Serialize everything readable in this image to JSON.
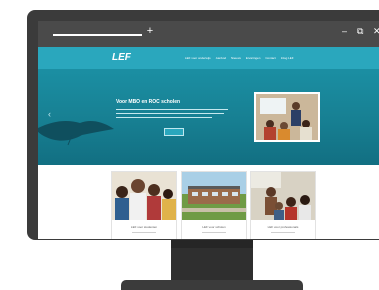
{
  "browser": {
    "new_tab_label": "+",
    "minimize_label": "–",
    "restore_label": "⧉",
    "close_label": "✕"
  },
  "site": {
    "logo": "LEF",
    "nav": [
      "LEF voor onderwijs",
      "Aanbod",
      "Nieuws",
      "Ervaringen",
      "Contact",
      "Inlog LEF"
    ],
    "hero_title": "Voor MBO en ROC scholen",
    "cards": [
      {
        "caption": "LEF voor studenten"
      },
      {
        "caption": "LEF voor scholen"
      },
      {
        "caption": "LEF voor professionals"
      }
    ]
  },
  "colors": {
    "accent": "#2aa7bd",
    "hero": "#177f92",
    "bezel": "#3b3b3b"
  }
}
